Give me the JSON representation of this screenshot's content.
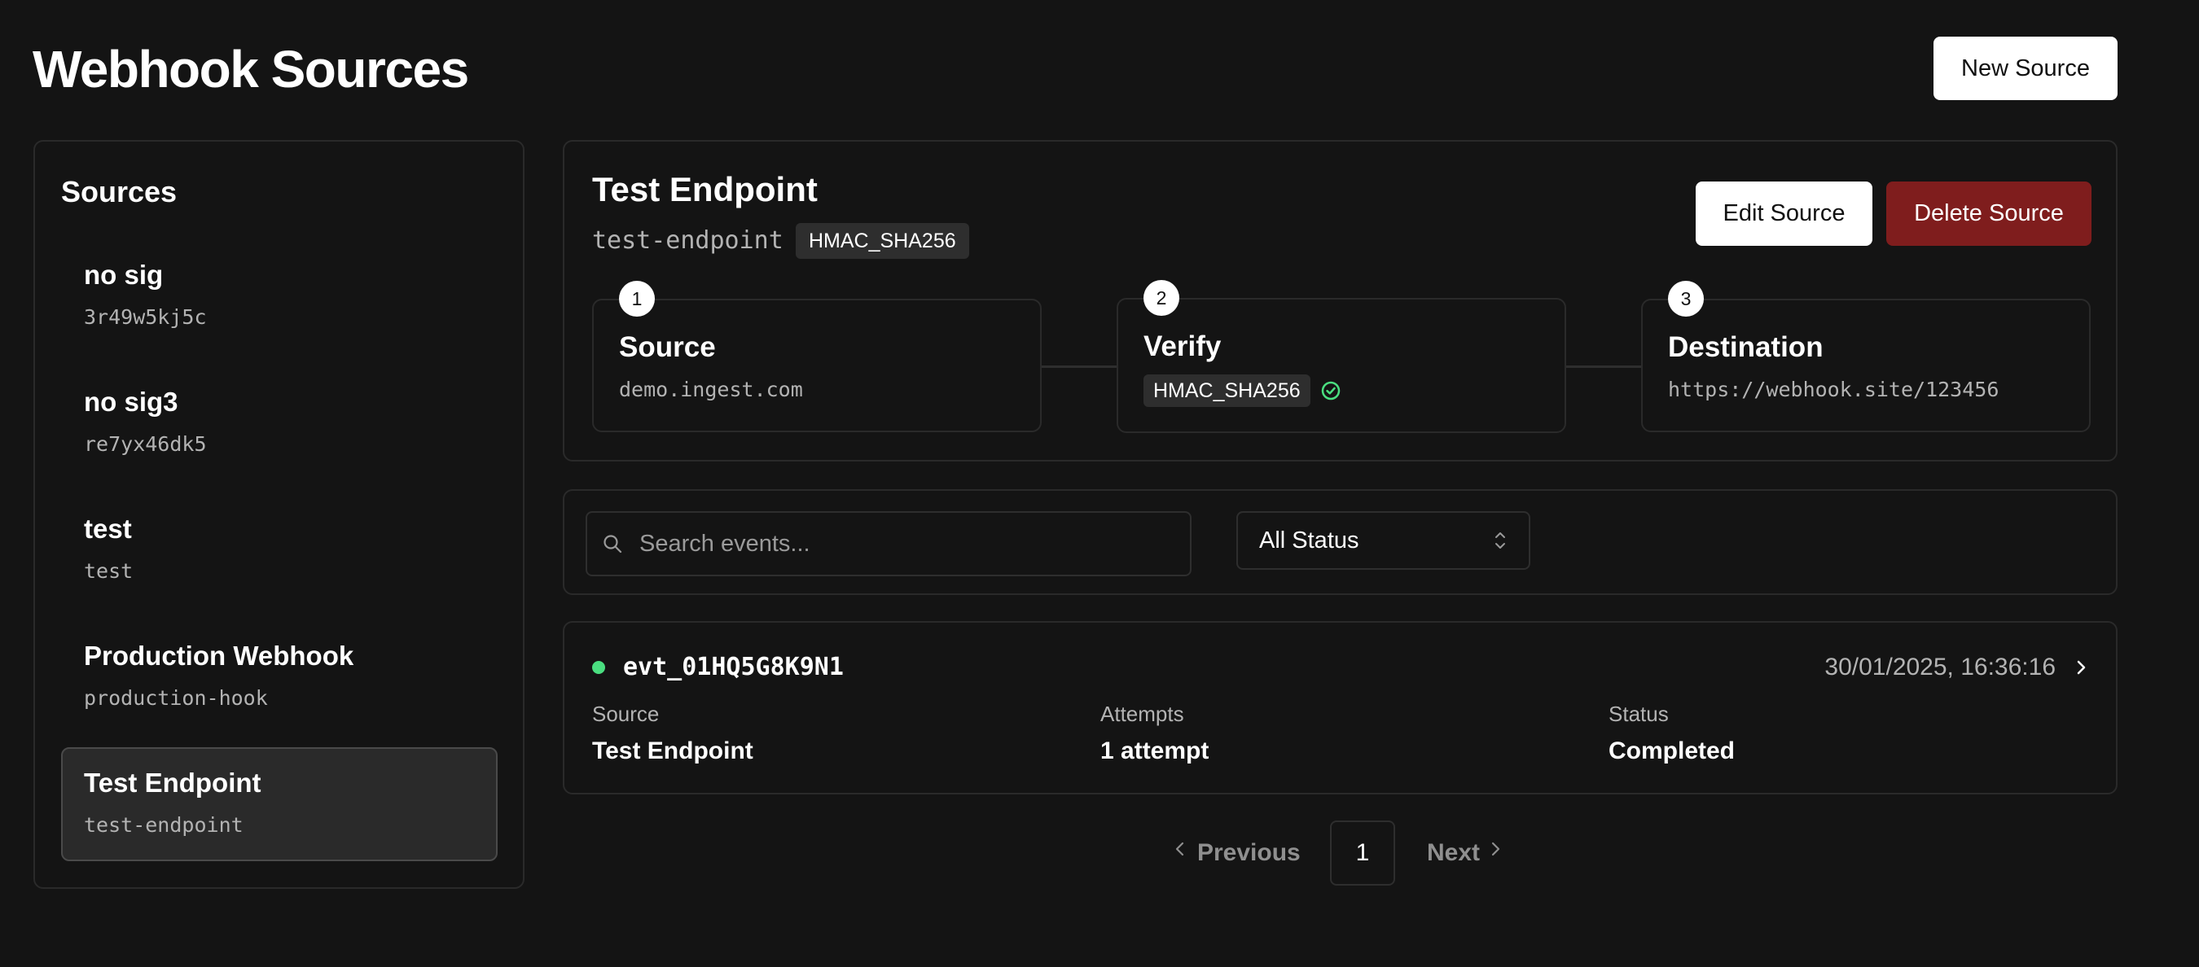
{
  "header": {
    "title": "Webhook Sources",
    "new_source_label": "New Source"
  },
  "sidebar": {
    "title": "Sources",
    "items": [
      {
        "name": "no sig",
        "slug": "3r49w5kj5c",
        "active": false
      },
      {
        "name": "no sig3",
        "slug": "re7yx46dk5",
        "active": false
      },
      {
        "name": "test",
        "slug": "test",
        "active": false
      },
      {
        "name": "Production Webhook",
        "slug": "production-hook",
        "active": false
      },
      {
        "name": "Test Endpoint",
        "slug": "test-endpoint",
        "active": true
      }
    ]
  },
  "detail": {
    "title": "Test Endpoint",
    "slug": "test-endpoint",
    "auth_badge": "HMAC_SHA256",
    "edit_label": "Edit Source",
    "delete_label": "Delete Source",
    "steps": [
      {
        "number": "1",
        "title": "Source",
        "value": "demo.ingest.com"
      },
      {
        "number": "2",
        "title": "Verify",
        "value": "HMAC_SHA256",
        "verified": true
      },
      {
        "number": "3",
        "title": "Destination",
        "value": "https://webhook.site/123456"
      }
    ]
  },
  "filters": {
    "search_placeholder": "Search events...",
    "status_value": "All Status"
  },
  "events": [
    {
      "id": "evt_01HQ5G8K9N1",
      "timestamp": "30/01/2025, 16:36:16",
      "status_color": "#4ade80",
      "source_label": "Source",
      "source_value": "Test Endpoint",
      "attempts_label": "Attempts",
      "attempts_value": "1 attempt",
      "status_label": "Status",
      "status_value": "Completed"
    }
  ],
  "pagination": {
    "previous_label": "Previous",
    "current_page": "1",
    "next_label": "Next"
  },
  "colors": {
    "background": "#141414",
    "danger": "#7f1d1d",
    "success": "#4ade80"
  }
}
